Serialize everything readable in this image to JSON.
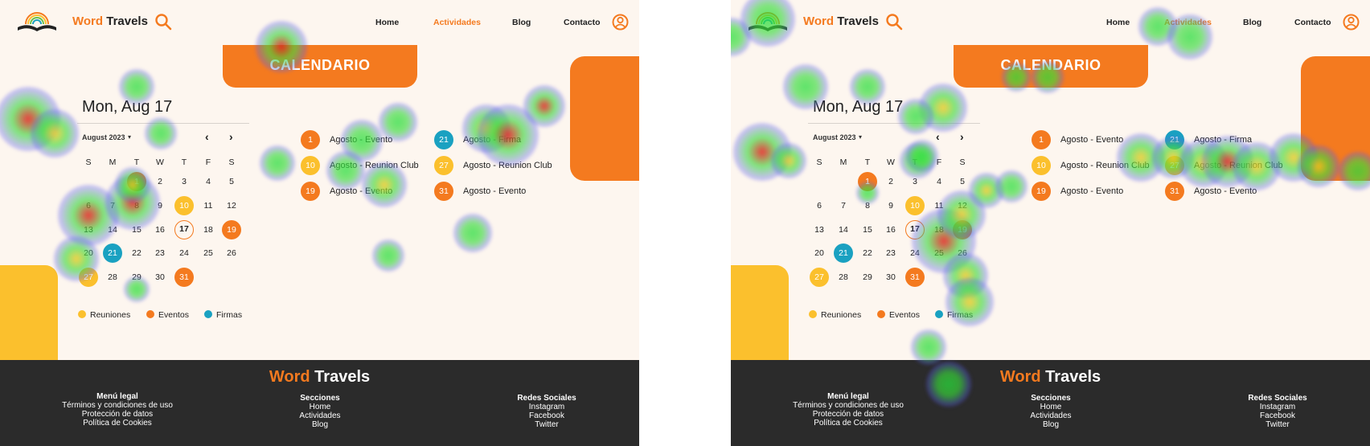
{
  "header": {
    "brand_word": "Word",
    "brand_travels": "Travels",
    "nav": [
      "Home",
      "Actividades",
      "Blog",
      "Contacto"
    ],
    "active_nav": "Actividades"
  },
  "banner": {
    "title": "CALENDARIO"
  },
  "calendar": {
    "selected_date": "Mon, Aug 17",
    "month_label": "August 2023",
    "weekdays": [
      "S",
      "M",
      "T",
      "W",
      "T",
      "F",
      "S"
    ],
    "weeks": [
      [
        "",
        "",
        "1",
        "2",
        "3",
        "4",
        "5"
      ],
      [
        "6",
        "7",
        "8",
        "9",
        "10",
        "11",
        "12"
      ],
      [
        "13",
        "14",
        "15",
        "16",
        "17",
        "18",
        "19"
      ],
      [
        "20",
        "21",
        "22",
        "23",
        "24",
        "25",
        "26"
      ],
      [
        "27",
        "28",
        "29",
        "30",
        "31",
        "",
        ""
      ]
    ],
    "highlighted": {
      "1": "orange",
      "10": "yellow",
      "19": "orange",
      "21": "blue",
      "27": "yellow",
      "31": "orange",
      "17": "today"
    }
  },
  "legend": [
    {
      "label": "Reuniones",
      "color": "#fbc02d"
    },
    {
      "label": "Eventos",
      "color": "#f47a1f"
    },
    {
      "label": "Firmas",
      "color": "#1aa1c1"
    }
  ],
  "events": [
    {
      "day": "1",
      "label": "Agosto - Evento",
      "color": "#f47a1f"
    },
    {
      "day": "10",
      "label": "Agosto - Reunion Club",
      "color": "#fbc02d"
    },
    {
      "day": "19",
      "label": "Agosto - Evento",
      "color": "#f47a1f"
    },
    {
      "day": "21",
      "label": "Agosto - Firma",
      "color": "#1aa1c1"
    },
    {
      "day": "27",
      "label": "Agosto - Reunion Club",
      "color": "#fbc02d"
    },
    {
      "day": "31",
      "label": "Agosto - Evento",
      "color": "#f47a1f"
    }
  ],
  "footer": {
    "brand_word": "Word",
    "brand_travels": "Travels",
    "legal": {
      "title": "Menú legal",
      "items": [
        "Términos y condiciones de uso",
        "Protección de datos",
        "Política de Cookies"
      ]
    },
    "sections": {
      "title": "Secciones",
      "items": [
        "Home",
        "Actividades",
        "Blog"
      ]
    },
    "social": {
      "title": "Redes Sociales",
      "items": [
        "Instagram",
        "Facebook",
        "Twitter"
      ]
    }
  },
  "colors": {
    "accent": "#f47a1f",
    "yellow": "#fbc02d",
    "blue": "#1aa1c1",
    "footer": "#2b2b2b",
    "background": "#fdf6ef"
  },
  "icons": {
    "search": "search-icon",
    "user": "user-icon",
    "logo": "book-rainbow-logo"
  }
}
